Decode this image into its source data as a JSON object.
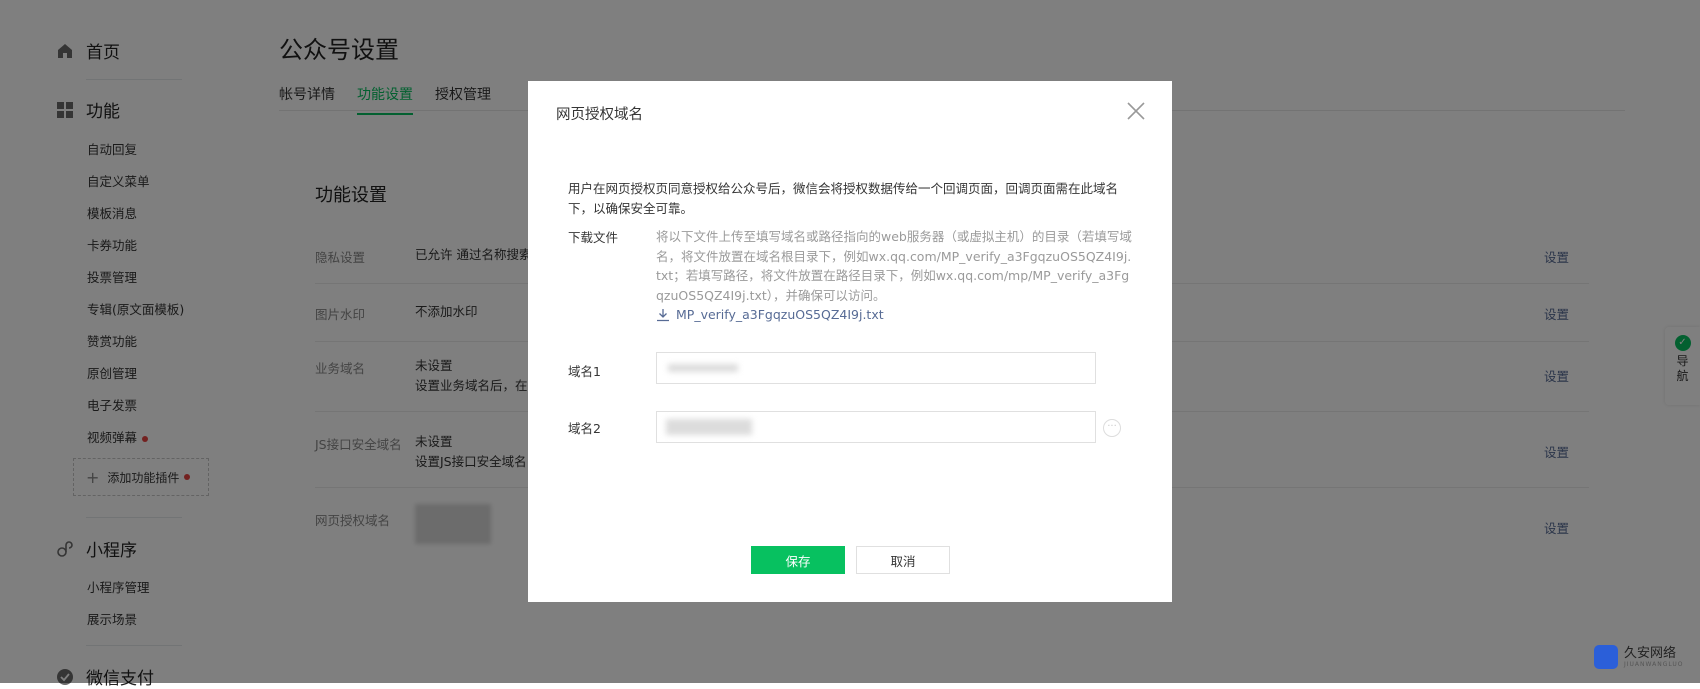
{
  "sidebar": {
    "home": "首页",
    "function_group": "功能",
    "function_items": [
      "自动回复",
      "自定义菜单",
      "模板消息",
      "卡券功能",
      "投票管理",
      "专辑(原文面模板)",
      "赞赏功能",
      "原创管理",
      "电子发票",
      "视频弹幕"
    ],
    "add_plugin": "添加功能插件",
    "miniprogram_group": "小程序",
    "miniprogram_items": [
      "小程序管理",
      "展示场景"
    ],
    "wechatpay_group": "微信支付"
  },
  "header": {
    "title": "公众号设置",
    "tabs": [
      "帐号详情",
      "功能设置",
      "授权管理"
    ],
    "active_tab": "功能设置"
  },
  "card": {
    "title": "功能设置",
    "rows": [
      {
        "label": "隐私设置",
        "value": "已允许 通过名称搜索",
        "action": "设置"
      },
      {
        "label": "图片水印",
        "value": "不添加水印",
        "action": "设置"
      },
      {
        "label": "业务域名",
        "value": "未设置",
        "value2": "设置业务域名后，在",
        "action": "设置"
      },
      {
        "label": "JS接口安全域名",
        "value": "未设置",
        "value2": "设置JS接口安全域名",
        "action": "设置"
      },
      {
        "label": "网页授权域名",
        "value": "",
        "action": "设置"
      }
    ]
  },
  "float_nav": {
    "label": "导航"
  },
  "dialog": {
    "title": "网页授权域名",
    "intro": "用户在网页授权页同意授权给公众号后，微信会将授权数据传给一个回调页面，回调页面需在此域名下，以确保安全可靠。",
    "download_label": "下载文件",
    "download_desc": "将以下文件上传至填写域名或路径指向的web服务器（或虚拟主机）的目录（若填写域名，将文件放置在域名根目录下，例如wx.qq.com/MP_verify_a3FgqzuOS5QZ4I9j.txt；若填写路径，将文件放置在路径目录下，例如wx.qq.com/mp/MP_verify_a3FgqzuOS5QZ4I9j.txt），并确保可以访问。",
    "download_file": "MP_verify_a3FgqzuOS5QZ4I9j.txt",
    "field1_label": "域名1",
    "field2_label": "域名2",
    "save_label": "保存",
    "cancel_label": "取消"
  },
  "watermark": {
    "text": "久安网络",
    "sub": "JIUANWANGLUO"
  },
  "colors": {
    "accent": "#07c160",
    "link": "#576b95",
    "overlay": "rgba(0,0,0,0.5)",
    "badge": "#e64340"
  }
}
